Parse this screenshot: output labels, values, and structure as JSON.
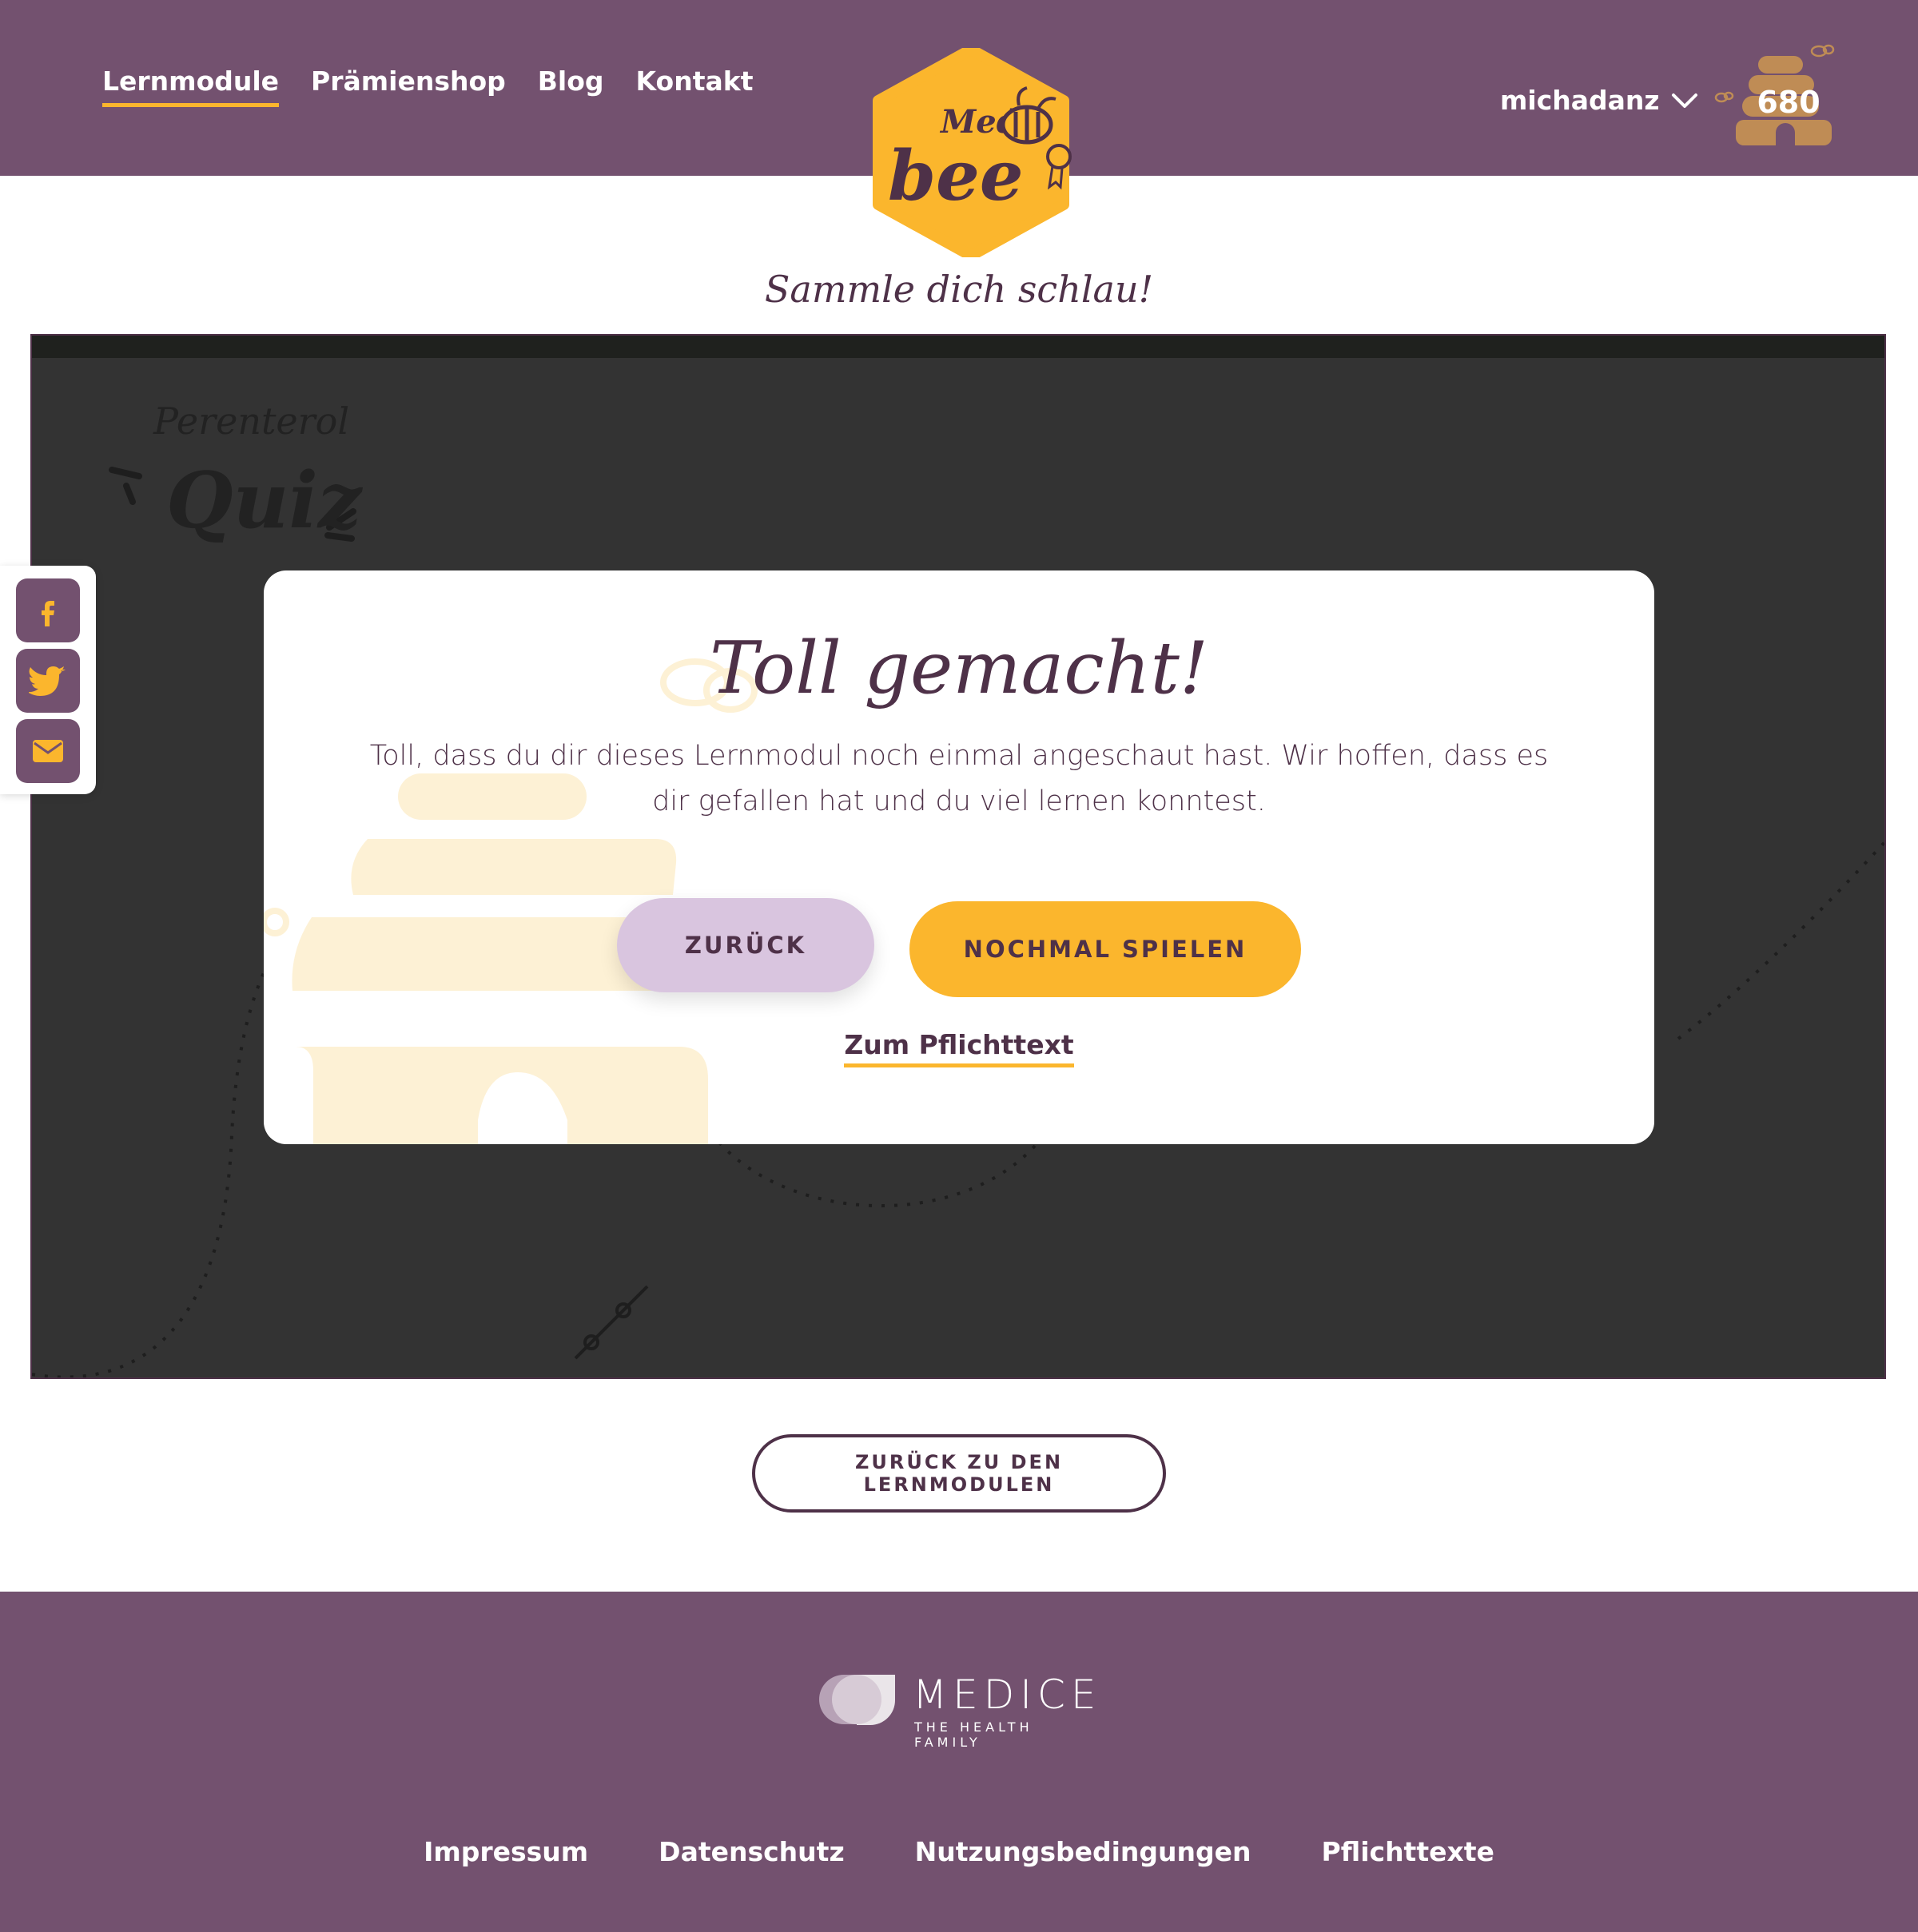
{
  "colors": {
    "brand_purple": "#73516f",
    "text_purple": "#4e3148",
    "honey_yellow": "#fbb62d",
    "lilac": "#d9c5df",
    "game_bg": "#333333"
  },
  "header": {
    "nav": [
      {
        "label": "Lernmodule",
        "active": true
      },
      {
        "label": "Prämienshop",
        "active": false
      },
      {
        "label": "Blog",
        "active": false
      },
      {
        "label": "Kontakt",
        "active": false
      }
    ],
    "logo": {
      "top_text": "Medi",
      "main_text": "bee",
      "icon": "bee-badge-icon"
    },
    "user": {
      "name": "michadanz",
      "icon": "chevron-down-icon"
    },
    "points": {
      "value": "680",
      "icon": "beehive-icon"
    }
  },
  "tagline": "Sammle dich schlau!",
  "game": {
    "subtitle": "Perenterol",
    "title": "Quiz"
  },
  "modal": {
    "title": "Toll gemacht!",
    "text": "Toll, dass du dir dieses Lernmodul noch einmal angeschaut hast. Wir hoffen, dass es dir gefallen hat und du viel lernen konntest.",
    "back_label": "ZURÜCK",
    "replay_label": "NOCHMAL SPIELEN",
    "link_label": "Zum Pflichttext"
  },
  "social": [
    {
      "icon": "facebook-icon"
    },
    {
      "icon": "twitter-icon"
    },
    {
      "icon": "mail-icon"
    }
  ],
  "back_to_modules_label": "ZURÜCK ZU DEN LERNMODULEN",
  "footer": {
    "brand_name": "MEDICE",
    "brand_sub": "THE HEALTH FAMILY",
    "links": [
      "Impressum",
      "Datenschutz",
      "Nutzungsbedingungen",
      "Pflichttexte"
    ]
  }
}
